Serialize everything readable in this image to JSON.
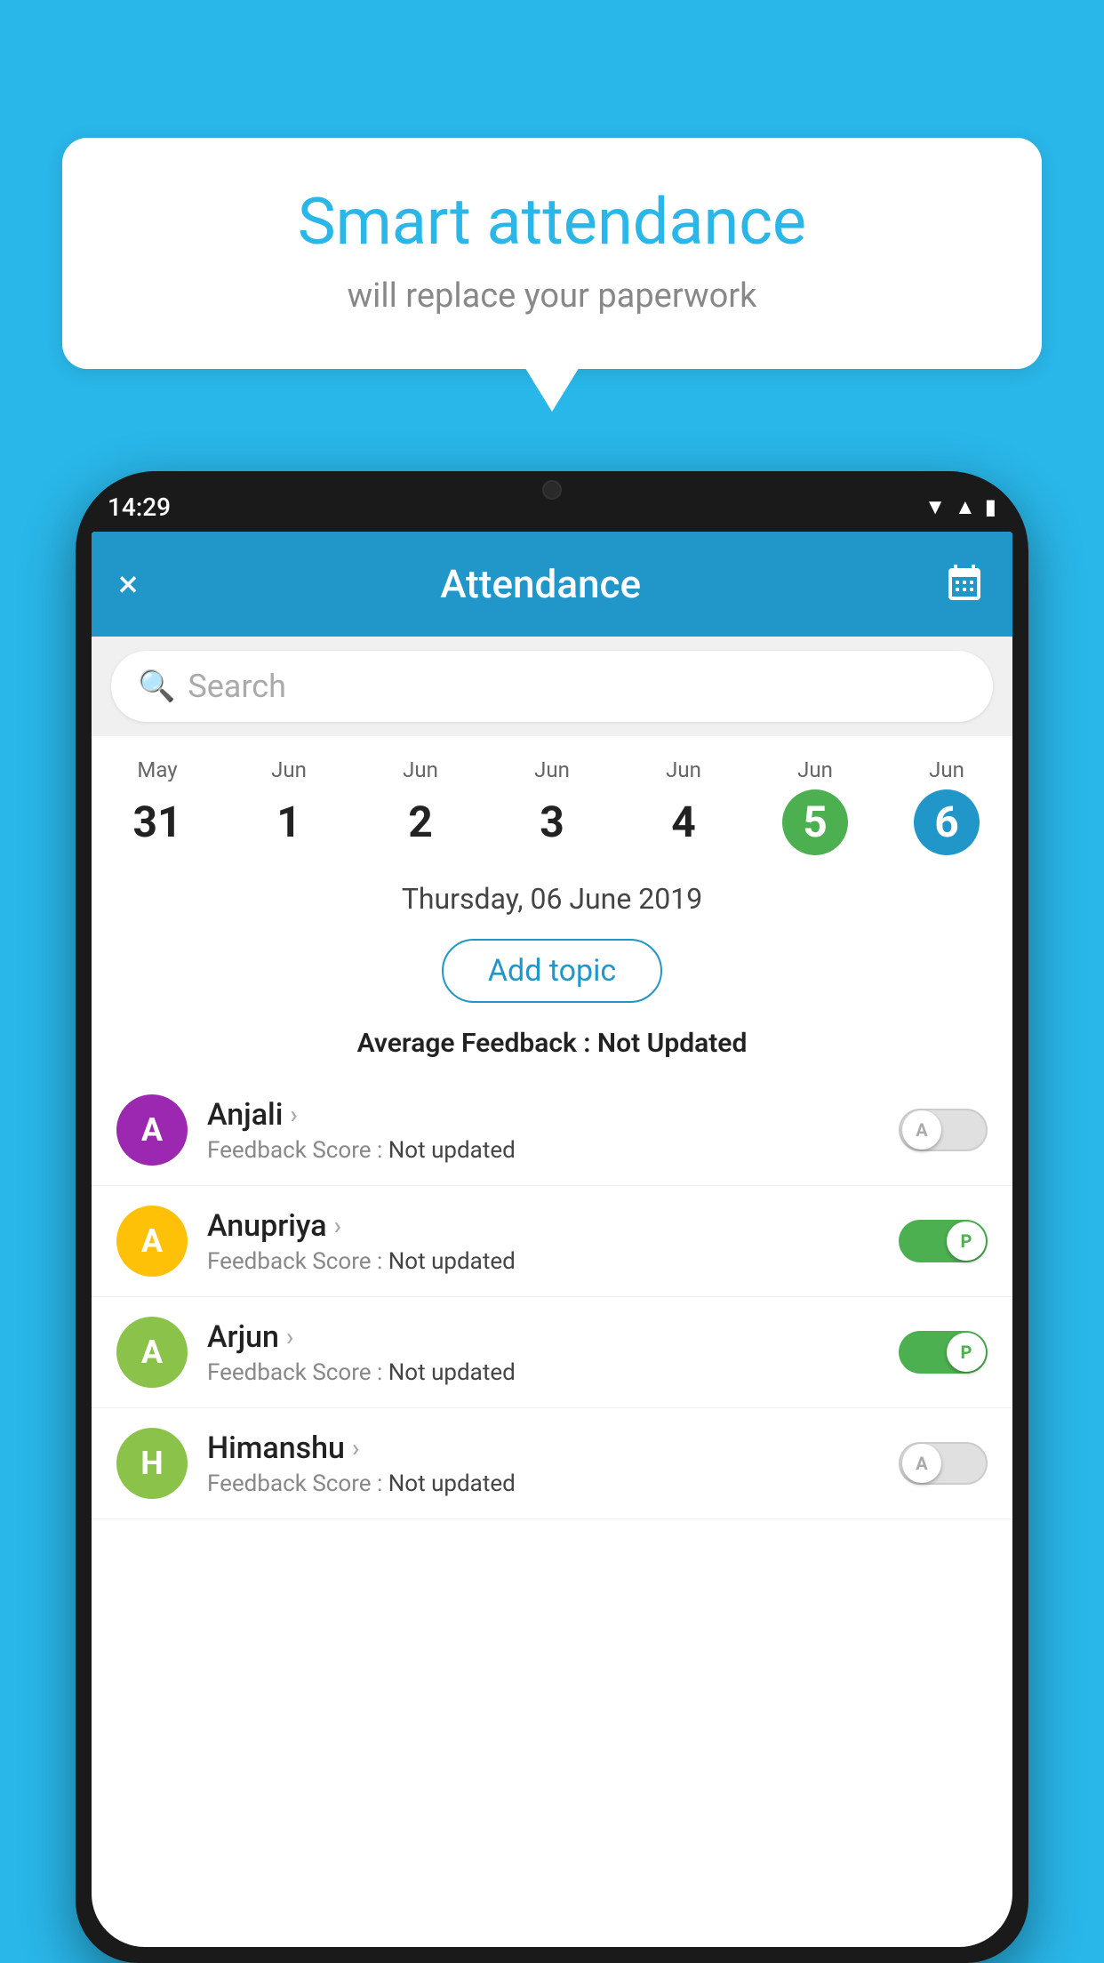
{
  "background_color": "#29B6E8",
  "speech_bubble": {
    "title": "Smart attendance",
    "subtitle": "will replace your paperwork"
  },
  "status_bar": {
    "time": "14:29",
    "icons": [
      "wifi",
      "signal",
      "battery"
    ]
  },
  "app_bar": {
    "title": "Attendance",
    "close_label": "×",
    "calendar_icon": "📅"
  },
  "search": {
    "placeholder": "Search"
  },
  "calendar": {
    "days": [
      {
        "month": "May",
        "date": "31",
        "state": "normal"
      },
      {
        "month": "Jun",
        "date": "1",
        "state": "normal"
      },
      {
        "month": "Jun",
        "date": "2",
        "state": "normal"
      },
      {
        "month": "Jun",
        "date": "3",
        "state": "normal"
      },
      {
        "month": "Jun",
        "date": "4",
        "state": "normal"
      },
      {
        "month": "Jun",
        "date": "5",
        "state": "today"
      },
      {
        "month": "Jun",
        "date": "6",
        "state": "selected"
      }
    ]
  },
  "selected_date": "Thursday, 06 June 2019",
  "add_topic_label": "Add topic",
  "average_feedback": {
    "label": "Average Feedback : ",
    "value": "Not Updated"
  },
  "students": [
    {
      "name": "Anjali",
      "avatar_letter": "A",
      "avatar_color": "#9C27B0",
      "feedback": "Not updated",
      "toggle_state": "off",
      "toggle_label": "A"
    },
    {
      "name": "Anupriya",
      "avatar_letter": "A",
      "avatar_color": "#FFC107",
      "feedback": "Not updated",
      "toggle_state": "on",
      "toggle_label": "P"
    },
    {
      "name": "Arjun",
      "avatar_letter": "A",
      "avatar_color": "#8BC34A",
      "feedback": "Not updated",
      "toggle_state": "on",
      "toggle_label": "P"
    },
    {
      "name": "Himanshu",
      "avatar_letter": "H",
      "avatar_color": "#8BC34A",
      "feedback": "Not updated",
      "toggle_state": "off",
      "toggle_label": "A"
    }
  ],
  "feedback_label": "Feedback Score : "
}
